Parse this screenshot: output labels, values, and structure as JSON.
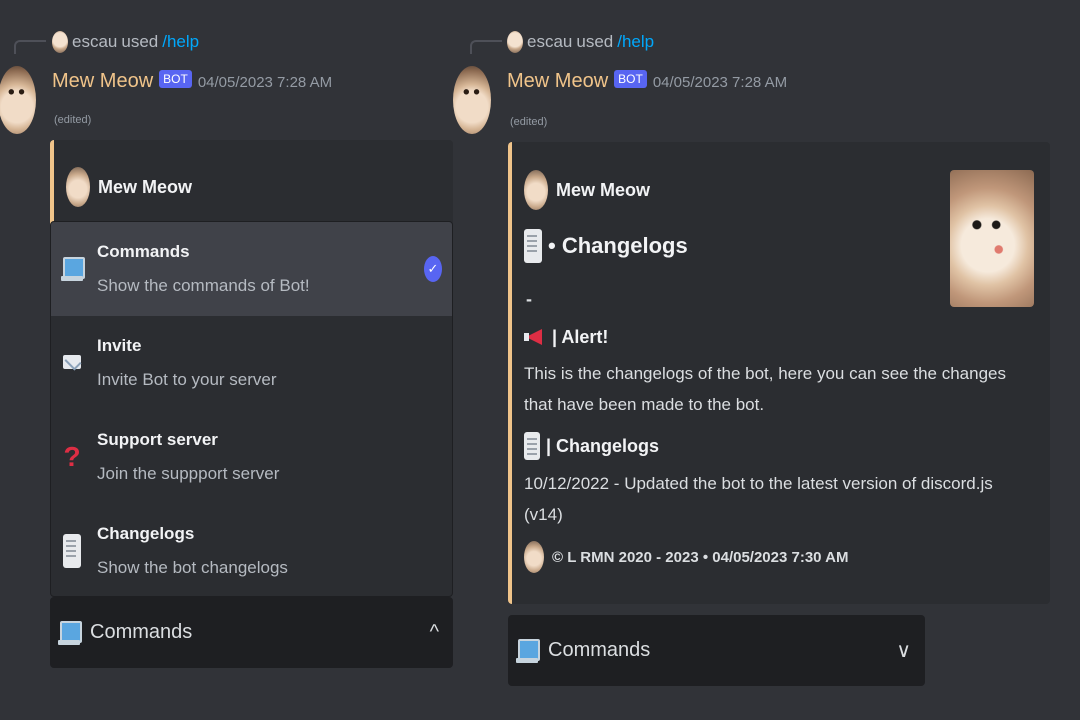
{
  "messages": [
    {
      "reply": {
        "user": "escau",
        "used": "used",
        "command": "/help"
      },
      "author": "Mew Meow",
      "bot_tag": "BOT",
      "timestamp": "04/05/2023 7:28 AM",
      "edited": "(edited)",
      "embed_author": "Mew Meow",
      "menu_items": [
        {
          "label": "Commands",
          "desc": "Show the commands of Bot!",
          "icon": "laptop-icon",
          "selected": true
        },
        {
          "label": "Invite",
          "desc": "Invite Bot to your server",
          "icon": "envelope-icon",
          "selected": false
        },
        {
          "label": "Support server",
          "desc": "Join the suppport server",
          "icon": "question-icon",
          "selected": false
        },
        {
          "label": "Changelogs",
          "desc": "Show the bot changelogs",
          "icon": "scroll-icon",
          "selected": false
        }
      ],
      "check_glyph": "✓",
      "select": {
        "value": "Commands",
        "chevron": "^"
      }
    },
    {
      "reply": {
        "user": "escau",
        "used": "used",
        "command": "/help"
      },
      "author": "Mew Meow",
      "bot_tag": "BOT",
      "timestamp": "04/05/2023 7:28 AM",
      "edited": "(edited)",
      "embed": {
        "author": "Mew Meow",
        "title": "• Changelogs",
        "dash": "-",
        "alert_title": "| Alert!",
        "alert_text_1": "This is the changelogs of the bot, here you can see the changes",
        "alert_text_2": "that have been made to the bot.",
        "changelogs_title": "| Changelogs",
        "changelog_line_1": "10/12/2022 - Updated the bot to the latest version of discord.js",
        "changelog_line_2": "(v14)",
        "footer": "© L RMN 2020 - 2023 • 04/05/2023 7:30 AM"
      },
      "select": {
        "value": "Commands",
        "chevron": "∨"
      }
    }
  ],
  "colors": {
    "background": "#313338",
    "embed_bg": "#2b2d31",
    "embed_accent": "#f0c48a",
    "bot_tag": "#5865f2",
    "link": "#00a8fc"
  }
}
